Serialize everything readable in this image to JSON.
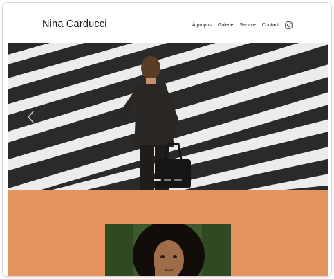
{
  "header": {
    "brand": "Nina Carducci",
    "nav": [
      {
        "label": "À propos"
      },
      {
        "label": "Galerie"
      },
      {
        "label": "Service"
      },
      {
        "label": "Contact"
      }
    ],
    "social_icon": "instagram-icon"
  },
  "hero": {
    "prev_icon": "chevron-left-icon",
    "slides_total": 3,
    "active_slide": 1
  },
  "colors": {
    "accent": "#e4955f",
    "text": "#1a1a1a"
  }
}
